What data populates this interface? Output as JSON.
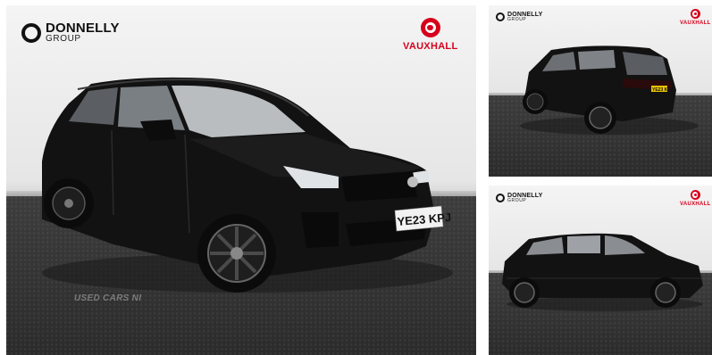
{
  "dealer": {
    "name": "DONNELLY",
    "group": "GROUP"
  },
  "brand": {
    "name": "VAUXHALL",
    "color": "#d6001c"
  },
  "main_photo": {
    "plate": "YE23 KPJ",
    "watermark": "USED CARS NI"
  },
  "thumb_rear": {
    "plate": "YE23 KPJ"
  },
  "icons": [
    "donnelly-logo-icon",
    "vauxhall-griffin-icon"
  ]
}
